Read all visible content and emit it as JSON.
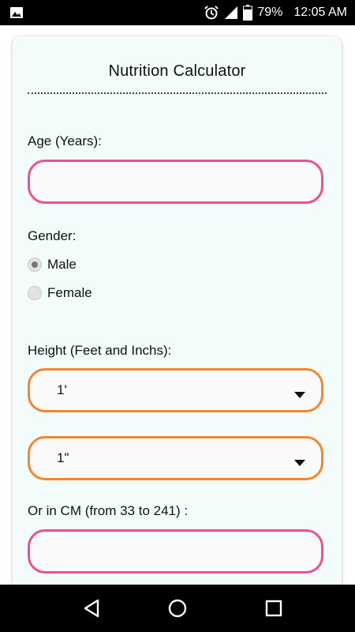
{
  "status_bar": {
    "battery_percent": "79%",
    "time": "12:05 AM",
    "icons": [
      "image-icon",
      "alarm-icon",
      "signal-icon",
      "battery-icon"
    ]
  },
  "app": {
    "title": "Nutrition Calculator"
  },
  "form": {
    "age_label": "Age (Years):",
    "age_value": "",
    "gender_label": "Gender:",
    "gender_options": [
      {
        "label": "Male",
        "selected": true
      },
      {
        "label": "Female",
        "selected": false
      }
    ],
    "height_label": "Height (Feet and Inchs):",
    "height_feet_value": "1'",
    "height_inches_value": "1\"",
    "cm_label": "Or in CM (from 33 to 241) :",
    "cm_value": ""
  },
  "colors": {
    "text_input_border": "#ef4f95",
    "select_border": "#f5862d",
    "card_background": "#f3fcfb"
  },
  "nav_bar": {
    "icons": [
      "back-icon",
      "home-icon",
      "recents-icon"
    ]
  }
}
